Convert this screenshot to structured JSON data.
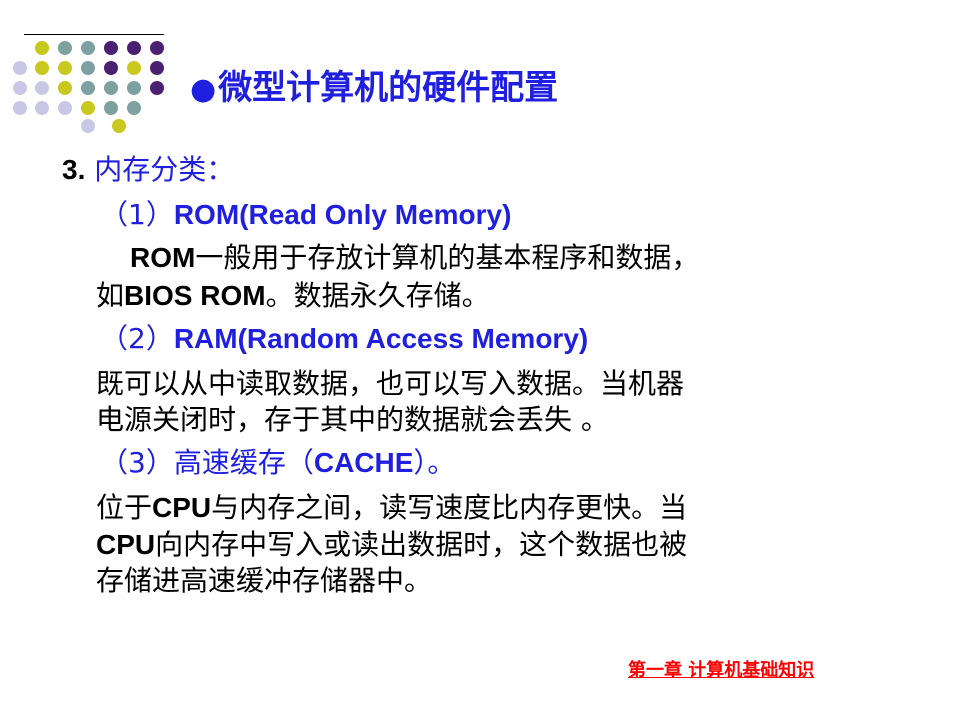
{
  "title": {
    "bullet": "●",
    "text": "微型计算机的硬件配置"
  },
  "section": {
    "number": "3.",
    "label": "内存分类："
  },
  "items": [
    {
      "prefix": "（1）",
      "heading": "ROM(Read Only Memory)",
      "lines": [
        {
          "parts": [
            "ROM",
            "一般用于存放计算机的基本程序和数据，"
          ]
        },
        {
          "parts": [
            "如",
            "BIOS ROM",
            "。数据永久存储。"
          ]
        }
      ]
    },
    {
      "prefix": "（2）",
      "heading": "RAM(Random Access Memory)",
      "lines": [
        {
          "parts": [
            "既可以从中读取数据，也可以写入数据。当机器"
          ]
        },
        {
          "parts": [
            "电源关闭时，存于其中的数据就会丢失 。"
          ]
        }
      ]
    },
    {
      "prefix": "（3）",
      "heading_cn": "高速缓存",
      "heading_paren_open": "（",
      "heading_en": "CACHE",
      "heading_paren_close": "）。",
      "lines": [
        {
          "parts": [
            "位于",
            "CPU",
            "与内存之间，读写速度比内存更快。当"
          ]
        },
        {
          "parts": [
            "CPU",
            "向内存中写入或读出数据时，这个数据也被"
          ]
        },
        {
          "parts": [
            "存储进高速缓冲存储器中。"
          ]
        }
      ]
    }
  ],
  "footer": "第一章  计算机基础知识",
  "colors": {
    "heading": "#1f1fe0",
    "body": "#000000",
    "footer": "#ff0000",
    "dot_olive": "#c8c81e",
    "dot_teal": "#7fa0a0",
    "dot_purple": "#4b2070",
    "dot_lavender": "#c8c8e6"
  },
  "decor_icon": "dot-grid-decoration"
}
